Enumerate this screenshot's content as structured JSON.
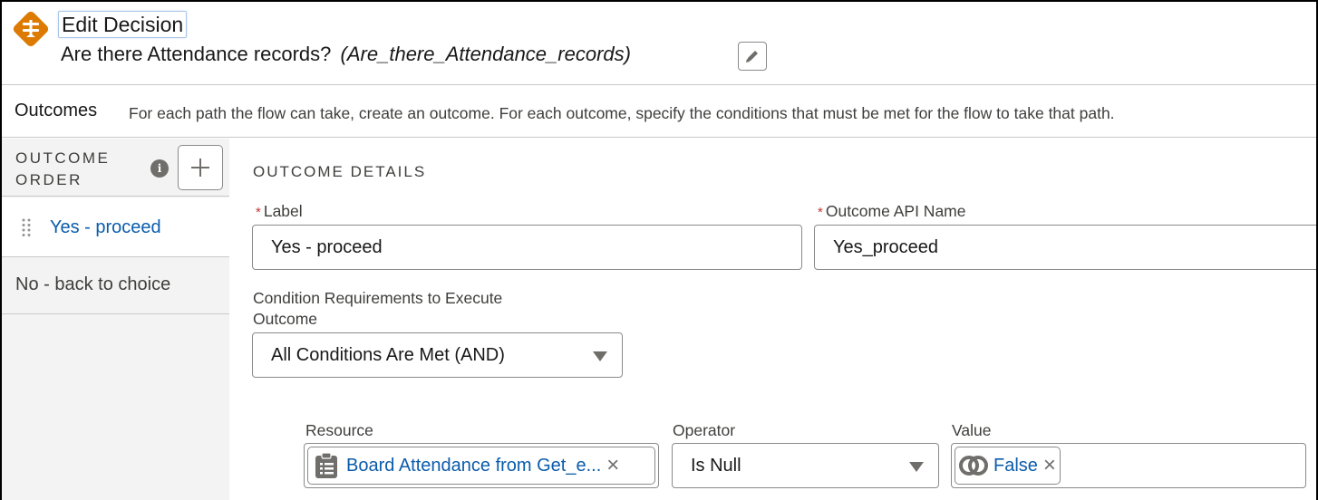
{
  "header": {
    "title": "Edit Decision",
    "element_label": "Are there Attendance records?",
    "element_api_name": "(Are_there_Attendance_records)",
    "icon": "decision-icon",
    "edit_icon": "pencil-icon",
    "accent_color": "#dd7a01"
  },
  "outcomes_bar": {
    "title": "Outcomes",
    "description": "For each path the flow can take, create an outcome. For each outcome, specify the conditions that must be met for the flow to take that path."
  },
  "sidebar": {
    "order_label_line1": "OUTCOME",
    "order_label_line2": "ORDER",
    "info_icon": "i",
    "add_icon": "+",
    "items": [
      {
        "label": "Yes - proceed",
        "selected": true
      },
      {
        "label": "No - back to choice",
        "selected": false
      }
    ]
  },
  "details": {
    "section_title": "OUTCOME DETAILS",
    "label_field": {
      "label": "Label",
      "required_mark": "*",
      "value": "Yes - proceed"
    },
    "api_name_field": {
      "label": "Outcome API Name",
      "required_mark": "*",
      "value": "Yes_proceed"
    },
    "condition_requirements": {
      "label_line1": "Condition Requirements to Execute",
      "label_line2": "Outcome",
      "selected": "All Conditions Are Met (AND)"
    },
    "condition": {
      "resource_label": "Resource",
      "resource_value": "Board Attendance from Get_e...",
      "operator_label": "Operator",
      "operator_value": "Is Null",
      "value_label": "Value",
      "value_value": "False",
      "remove_icon": "×"
    }
  }
}
